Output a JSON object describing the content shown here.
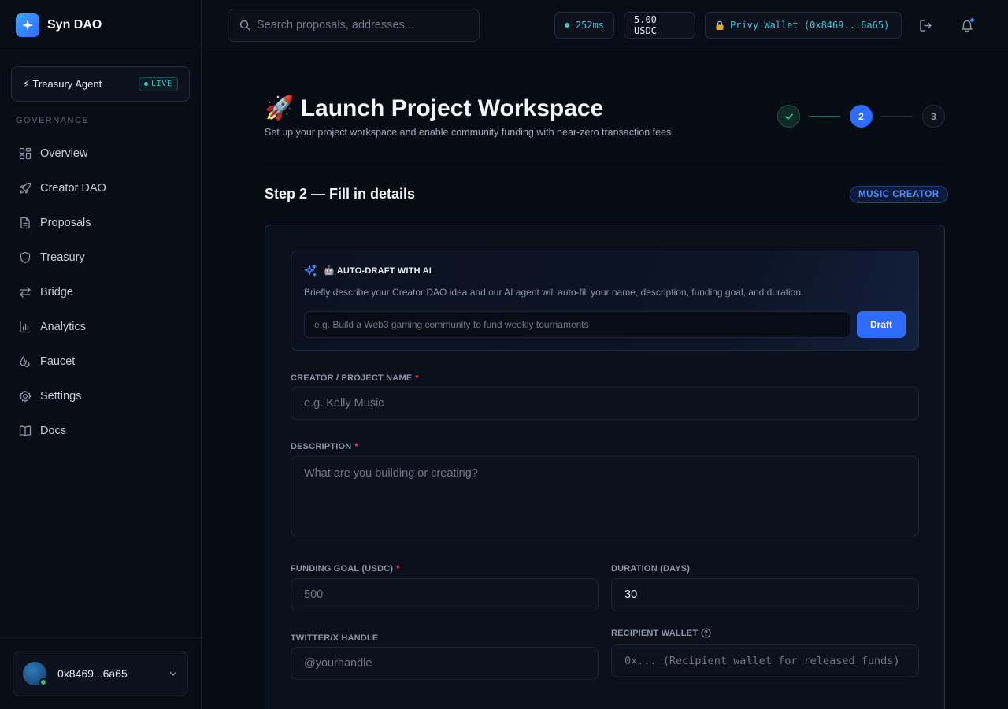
{
  "app": {
    "name": "Syn DAO"
  },
  "sidebar": {
    "agent": {
      "label": "⚡ Treasury Agent",
      "badge": "LIVE"
    },
    "section_title": "GOVERNANCE",
    "items": [
      {
        "label": "Overview",
        "icon": "grid-icon"
      },
      {
        "label": "Creator DAO",
        "icon": "rocket-icon"
      },
      {
        "label": "Proposals",
        "icon": "document-icon"
      },
      {
        "label": "Treasury",
        "icon": "shield-icon"
      },
      {
        "label": "Bridge",
        "icon": "arrows-swap-icon"
      },
      {
        "label": "Analytics",
        "icon": "bar-chart-icon"
      },
      {
        "label": "Faucet",
        "icon": "droplet-icon"
      },
      {
        "label": "Settings",
        "icon": "gear-icon"
      },
      {
        "label": "Docs",
        "icon": "book-icon"
      }
    ],
    "account": {
      "address": "0x8469...6a65"
    }
  },
  "topbar": {
    "search_placeholder": "Search proposals, addresses...",
    "latency": "252ms",
    "balance": "5.00 USDC",
    "wallet": "Privy Wallet (0x8469...6a65)"
  },
  "page": {
    "title": "🚀 Launch Project Workspace",
    "subtitle": "Set up your project workspace and enable community funding with near-zero transaction fees.",
    "steps": {
      "current": 2,
      "step2_label": "2",
      "step3_label": "3"
    },
    "section_heading": "Step 2 — Fill in details",
    "category_badge": "MUSIC CREATOR"
  },
  "ai_draft": {
    "title": "🤖 AUTO-DRAFT WITH AI",
    "description": "Briefly describe your Creator DAO idea and our AI agent will auto-fill your name, description, funding goal, and duration.",
    "input_placeholder": "e.g. Build a Web3 gaming community to fund weekly tournaments",
    "button": "Draft"
  },
  "form": {
    "name": {
      "label": "CREATOR / PROJECT NAME",
      "required": "*",
      "placeholder": "e.g. Kelly Music",
      "value": ""
    },
    "description": {
      "label": "DESCRIPTION",
      "required": "*",
      "placeholder": "What are you building or creating?",
      "value": ""
    },
    "funding_goal": {
      "label": "FUNDING GOAL (USDC)",
      "required": "*",
      "placeholder": "500",
      "value": ""
    },
    "duration": {
      "label": "DURATION (DAYS)",
      "value": "30"
    },
    "twitter": {
      "label": "TWITTER/X HANDLE",
      "placeholder": "@yourhandle",
      "value": ""
    },
    "recipient_wallet": {
      "label": "RECIPIENT WALLET",
      "placeholder": "0x... (Recipient wallet for released funds)",
      "value": ""
    }
  },
  "colors": {
    "accent": "#2f6bff",
    "live": "#39c7d8",
    "success": "#34d399",
    "required": "#ef4444"
  }
}
